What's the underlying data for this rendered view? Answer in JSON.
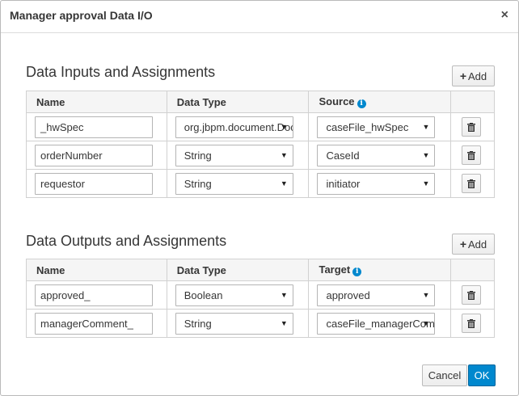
{
  "dialog": {
    "title": "Manager approval Data I/O",
    "close_glyph": "×"
  },
  "inputs": {
    "heading": "Data Inputs and Assignments",
    "add_label": "Add",
    "columns": [
      "Name",
      "Data Type",
      "Source"
    ],
    "rows": [
      {
        "name": "_hwSpec",
        "data_type": "org.jbpm.document.Document",
        "source": "caseFile_hwSpec"
      },
      {
        "name": "orderNumber",
        "data_type": "String",
        "source": "CaseId"
      },
      {
        "name": "requestor",
        "data_type": "String",
        "source": "initiator"
      }
    ]
  },
  "outputs": {
    "heading": "Data Outputs and Assignments",
    "add_label": "Add",
    "columns": [
      "Name",
      "Data Type",
      "Target"
    ],
    "rows": [
      {
        "name": "approved_",
        "data_type": "Boolean",
        "target": "approved"
      },
      {
        "name": "managerComment_",
        "data_type": "String",
        "target": "caseFile_managerComment"
      }
    ]
  },
  "footer": {
    "cancel_label": "Cancel",
    "ok_label": "OK"
  },
  "icons": {
    "plus": "plus-icon",
    "trash": "trash-icon",
    "info": "info-icon",
    "caret": "caret-down-icon"
  },
  "colors": {
    "primary": "#0088ce",
    "header_bg": "#f5f5f5",
    "border": "#d1d1d1"
  }
}
